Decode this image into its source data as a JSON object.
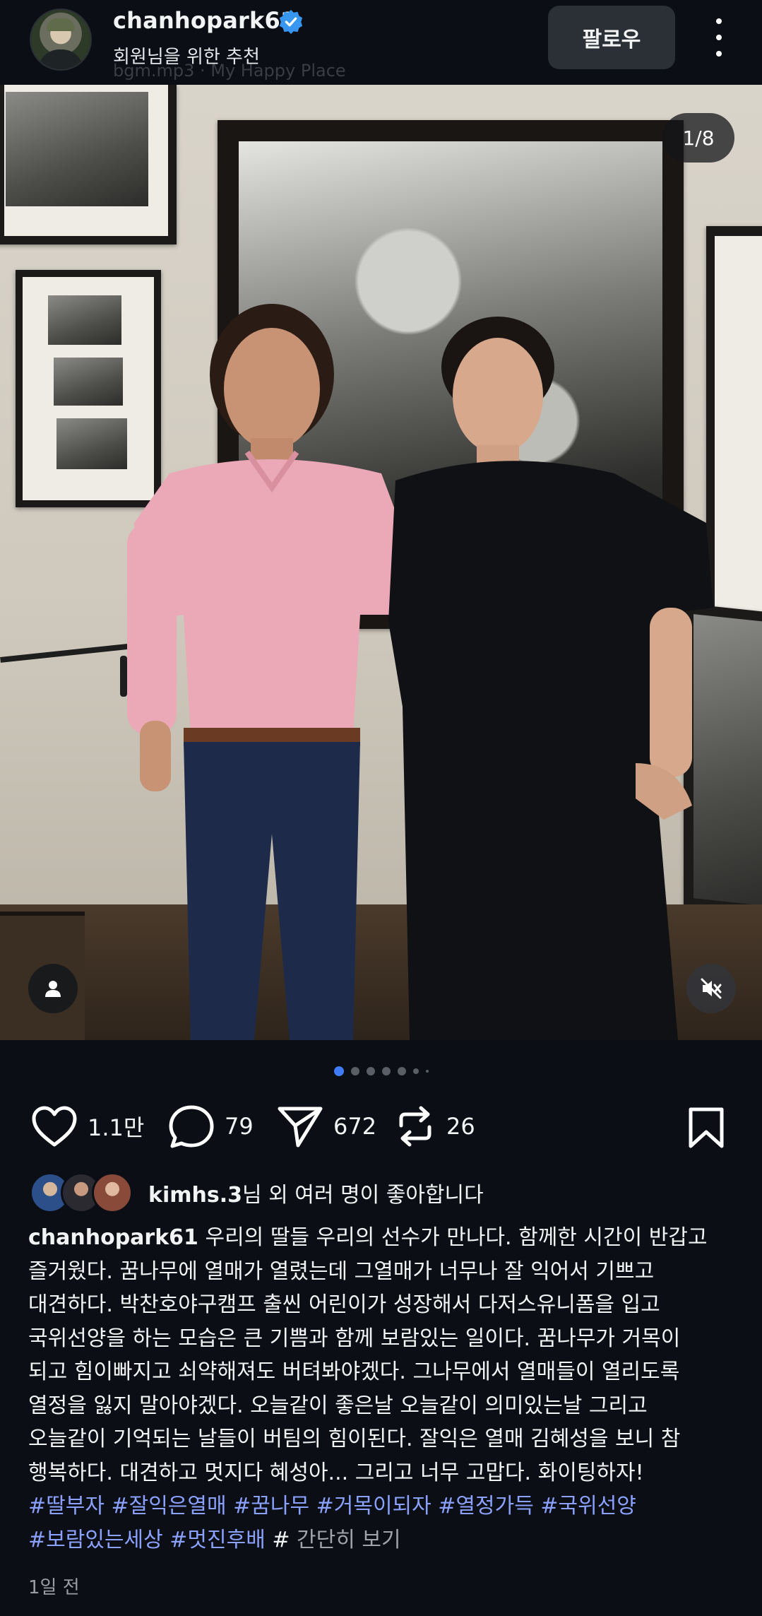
{
  "header": {
    "username": "chanhopark61",
    "subtitle": "회원님을 위한 추천",
    "ghost_text": "bgm.mp3 · My Happy Place",
    "follow_label": "팔로우",
    "verified_icon": "verified-badge-icon",
    "more_icon": "more-vertical-icon"
  },
  "media": {
    "counter": "1/8",
    "user_tag_icon": "person-icon",
    "mute_icon": "muted-speaker-icon",
    "carousel_total": 8,
    "carousel_active_index": 0
  },
  "actions": {
    "like_count": "1.1만",
    "comment_count": "79",
    "share_count": "672",
    "repost_count": "26"
  },
  "likes": {
    "liker": "kimhs.3",
    "suffix": "님 외 여러 명이 좋아합니다"
  },
  "caption": {
    "username": "chanhopark61",
    "lines": [
      "우리의 딸들 우리의 선수가 만나다. 함께한 시간이 반갑고",
      "즐거웠다.  꿈나무에 열매가 열렸는데 그열매가 너무나 잘 익어서 기쁘고",
      "대견하다.  박찬호야구캠프 출씬 어린이가 성장해서 다저스유니폼을 입고",
      "국위선양을 하는 모습은 큰 기쁨과 함께 보람있는 일이다. 꿈나무가 거목이",
      "되고 힘이빠지고 쇠약해져도 버텨봐야겠다. 그나무에서 열매들이 열리도록",
      "열정을 잃지 말아야겠다. 오늘같이 좋은날 오늘같이 의미있는날 그리고",
      "오늘같이 기억되는 날들이 버팀의 힘이된다. 잘익은 열매 김혜성을 보니 참",
      "행복하다.  대견하고 멋지다 혜성아... 그리고 너무 고맙다. 화이팅하자!"
    ],
    "hashtags_line1": "#딸부자 #잘익은열매 #꿈나무 #거목이되자 #열정가득 #국위선양",
    "hashtags_line2": "#보람있는세상 #멋진후배",
    "more_prefix": "# ",
    "more_label": "간단히 보기"
  },
  "timestamp": "1일 전",
  "colors": {
    "background": "#0b0e14",
    "hashtag": "#8aa1ff",
    "verified": "#3797f0"
  }
}
